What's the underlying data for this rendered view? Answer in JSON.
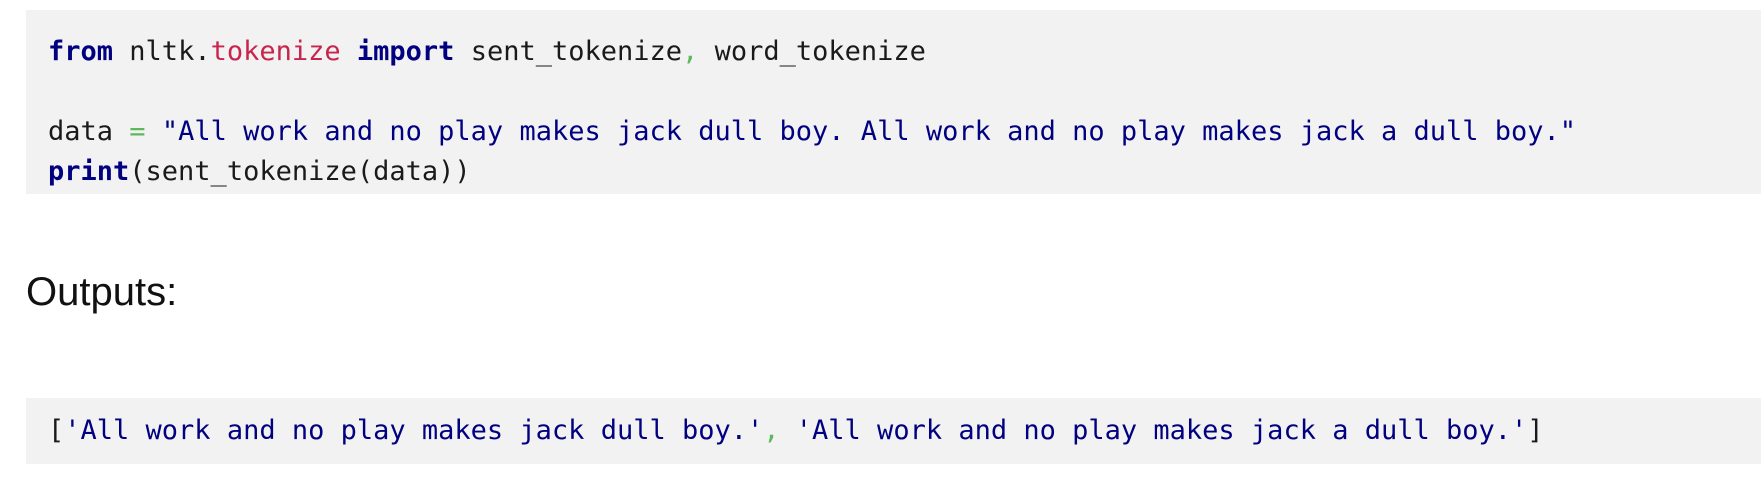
{
  "code_input": {
    "line1": {
      "kw_from": "from",
      "pkg": "nltk.",
      "module": "tokenize",
      "kw_import": "import",
      "name1": "sent_tokenize",
      "comma": ",",
      "name2": "word_tokenize"
    },
    "line3": {
      "var": "data",
      "eq": "=",
      "string": "\"All work and no play makes jack dull boy. All work and no play makes jack a dull boy.\""
    },
    "line4": {
      "kw_print": "print",
      "call": "(sent_tokenize(data))"
    }
  },
  "outputs_heading": "Outputs:",
  "code_output": {
    "open": "[",
    "item1": "'All work and no play makes jack dull boy.'",
    "comma": ",",
    "item2": "'All work and no play makes jack a dull boy.'",
    "close": "]"
  }
}
